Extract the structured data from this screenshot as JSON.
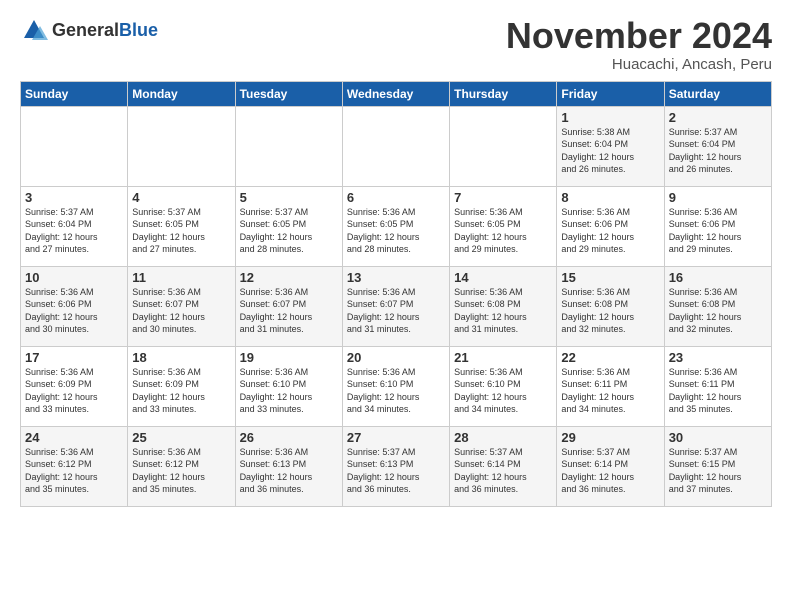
{
  "logo": {
    "general": "General",
    "blue": "Blue"
  },
  "title": "November 2024",
  "location": "Huacachi, Ancash, Peru",
  "days_of_week": [
    "Sunday",
    "Monday",
    "Tuesday",
    "Wednesday",
    "Thursday",
    "Friday",
    "Saturday"
  ],
  "weeks": [
    [
      {
        "day": "",
        "info": ""
      },
      {
        "day": "",
        "info": ""
      },
      {
        "day": "",
        "info": ""
      },
      {
        "day": "",
        "info": ""
      },
      {
        "day": "",
        "info": ""
      },
      {
        "day": "1",
        "info": "Sunrise: 5:38 AM\nSunset: 6:04 PM\nDaylight: 12 hours\nand 26 minutes."
      },
      {
        "day": "2",
        "info": "Sunrise: 5:37 AM\nSunset: 6:04 PM\nDaylight: 12 hours\nand 26 minutes."
      }
    ],
    [
      {
        "day": "3",
        "info": "Sunrise: 5:37 AM\nSunset: 6:04 PM\nDaylight: 12 hours\nand 27 minutes."
      },
      {
        "day": "4",
        "info": "Sunrise: 5:37 AM\nSunset: 6:05 PM\nDaylight: 12 hours\nand 27 minutes."
      },
      {
        "day": "5",
        "info": "Sunrise: 5:37 AM\nSunset: 6:05 PM\nDaylight: 12 hours\nand 28 minutes."
      },
      {
        "day": "6",
        "info": "Sunrise: 5:36 AM\nSunset: 6:05 PM\nDaylight: 12 hours\nand 28 minutes."
      },
      {
        "day": "7",
        "info": "Sunrise: 5:36 AM\nSunset: 6:05 PM\nDaylight: 12 hours\nand 29 minutes."
      },
      {
        "day": "8",
        "info": "Sunrise: 5:36 AM\nSunset: 6:06 PM\nDaylight: 12 hours\nand 29 minutes."
      },
      {
        "day": "9",
        "info": "Sunrise: 5:36 AM\nSunset: 6:06 PM\nDaylight: 12 hours\nand 29 minutes."
      }
    ],
    [
      {
        "day": "10",
        "info": "Sunrise: 5:36 AM\nSunset: 6:06 PM\nDaylight: 12 hours\nand 30 minutes."
      },
      {
        "day": "11",
        "info": "Sunrise: 5:36 AM\nSunset: 6:07 PM\nDaylight: 12 hours\nand 30 minutes."
      },
      {
        "day": "12",
        "info": "Sunrise: 5:36 AM\nSunset: 6:07 PM\nDaylight: 12 hours\nand 31 minutes."
      },
      {
        "day": "13",
        "info": "Sunrise: 5:36 AM\nSunset: 6:07 PM\nDaylight: 12 hours\nand 31 minutes."
      },
      {
        "day": "14",
        "info": "Sunrise: 5:36 AM\nSunset: 6:08 PM\nDaylight: 12 hours\nand 31 minutes."
      },
      {
        "day": "15",
        "info": "Sunrise: 5:36 AM\nSunset: 6:08 PM\nDaylight: 12 hours\nand 32 minutes."
      },
      {
        "day": "16",
        "info": "Sunrise: 5:36 AM\nSunset: 6:08 PM\nDaylight: 12 hours\nand 32 minutes."
      }
    ],
    [
      {
        "day": "17",
        "info": "Sunrise: 5:36 AM\nSunset: 6:09 PM\nDaylight: 12 hours\nand 33 minutes."
      },
      {
        "day": "18",
        "info": "Sunrise: 5:36 AM\nSunset: 6:09 PM\nDaylight: 12 hours\nand 33 minutes."
      },
      {
        "day": "19",
        "info": "Sunrise: 5:36 AM\nSunset: 6:10 PM\nDaylight: 12 hours\nand 33 minutes."
      },
      {
        "day": "20",
        "info": "Sunrise: 5:36 AM\nSunset: 6:10 PM\nDaylight: 12 hours\nand 34 minutes."
      },
      {
        "day": "21",
        "info": "Sunrise: 5:36 AM\nSunset: 6:10 PM\nDaylight: 12 hours\nand 34 minutes."
      },
      {
        "day": "22",
        "info": "Sunrise: 5:36 AM\nSunset: 6:11 PM\nDaylight: 12 hours\nand 34 minutes."
      },
      {
        "day": "23",
        "info": "Sunrise: 5:36 AM\nSunset: 6:11 PM\nDaylight: 12 hours\nand 35 minutes."
      }
    ],
    [
      {
        "day": "24",
        "info": "Sunrise: 5:36 AM\nSunset: 6:12 PM\nDaylight: 12 hours\nand 35 minutes."
      },
      {
        "day": "25",
        "info": "Sunrise: 5:36 AM\nSunset: 6:12 PM\nDaylight: 12 hours\nand 35 minutes."
      },
      {
        "day": "26",
        "info": "Sunrise: 5:36 AM\nSunset: 6:13 PM\nDaylight: 12 hours\nand 36 minutes."
      },
      {
        "day": "27",
        "info": "Sunrise: 5:37 AM\nSunset: 6:13 PM\nDaylight: 12 hours\nand 36 minutes."
      },
      {
        "day": "28",
        "info": "Sunrise: 5:37 AM\nSunset: 6:14 PM\nDaylight: 12 hours\nand 36 minutes."
      },
      {
        "day": "29",
        "info": "Sunrise: 5:37 AM\nSunset: 6:14 PM\nDaylight: 12 hours\nand 36 minutes."
      },
      {
        "day": "30",
        "info": "Sunrise: 5:37 AM\nSunset: 6:15 PM\nDaylight: 12 hours\nand 37 minutes."
      }
    ]
  ]
}
